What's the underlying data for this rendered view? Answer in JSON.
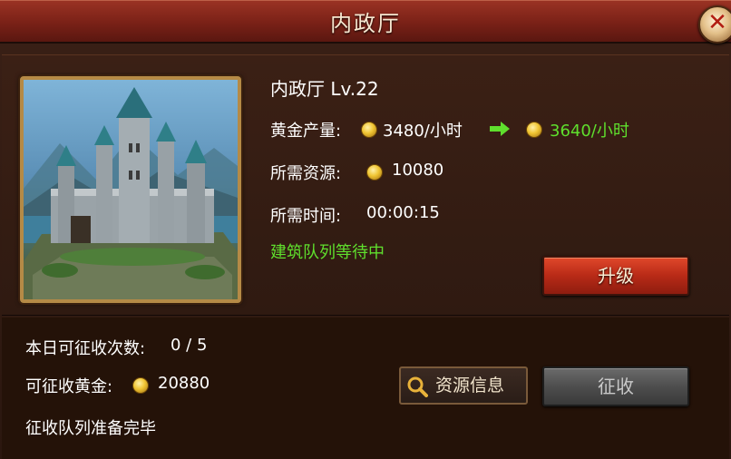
{
  "window": {
    "title": "内政厅"
  },
  "building": {
    "name_level": "内政厅 Lv.22",
    "gold_label": "黄金产量:",
    "gold_current": "3480/小时",
    "gold_next": "3640/小时",
    "cost_label": "所需资源:",
    "cost_value": "10080",
    "time_label": "所需时间:",
    "time_value": "00:00:15",
    "queue_status": "建筑队列等待中",
    "upgrade_label": "升级"
  },
  "levy": {
    "count_label": "本日可征收次数:",
    "count_value": "0 / 5",
    "gold_label": "可征收黄金:",
    "gold_value": "20880",
    "queue_status": "征收队列准备完毕",
    "info_button": "资源信息",
    "collect_button": "征收"
  },
  "icons": {
    "close": "close-icon",
    "coin": "gold-coin-icon",
    "arrow": "arrow-right-icon",
    "magnifier": "magnifier-icon"
  },
  "colors": {
    "accent_green": "#5fdf2d",
    "upgrade_red": "#b82a17",
    "title_bar": "#7a2117"
  }
}
